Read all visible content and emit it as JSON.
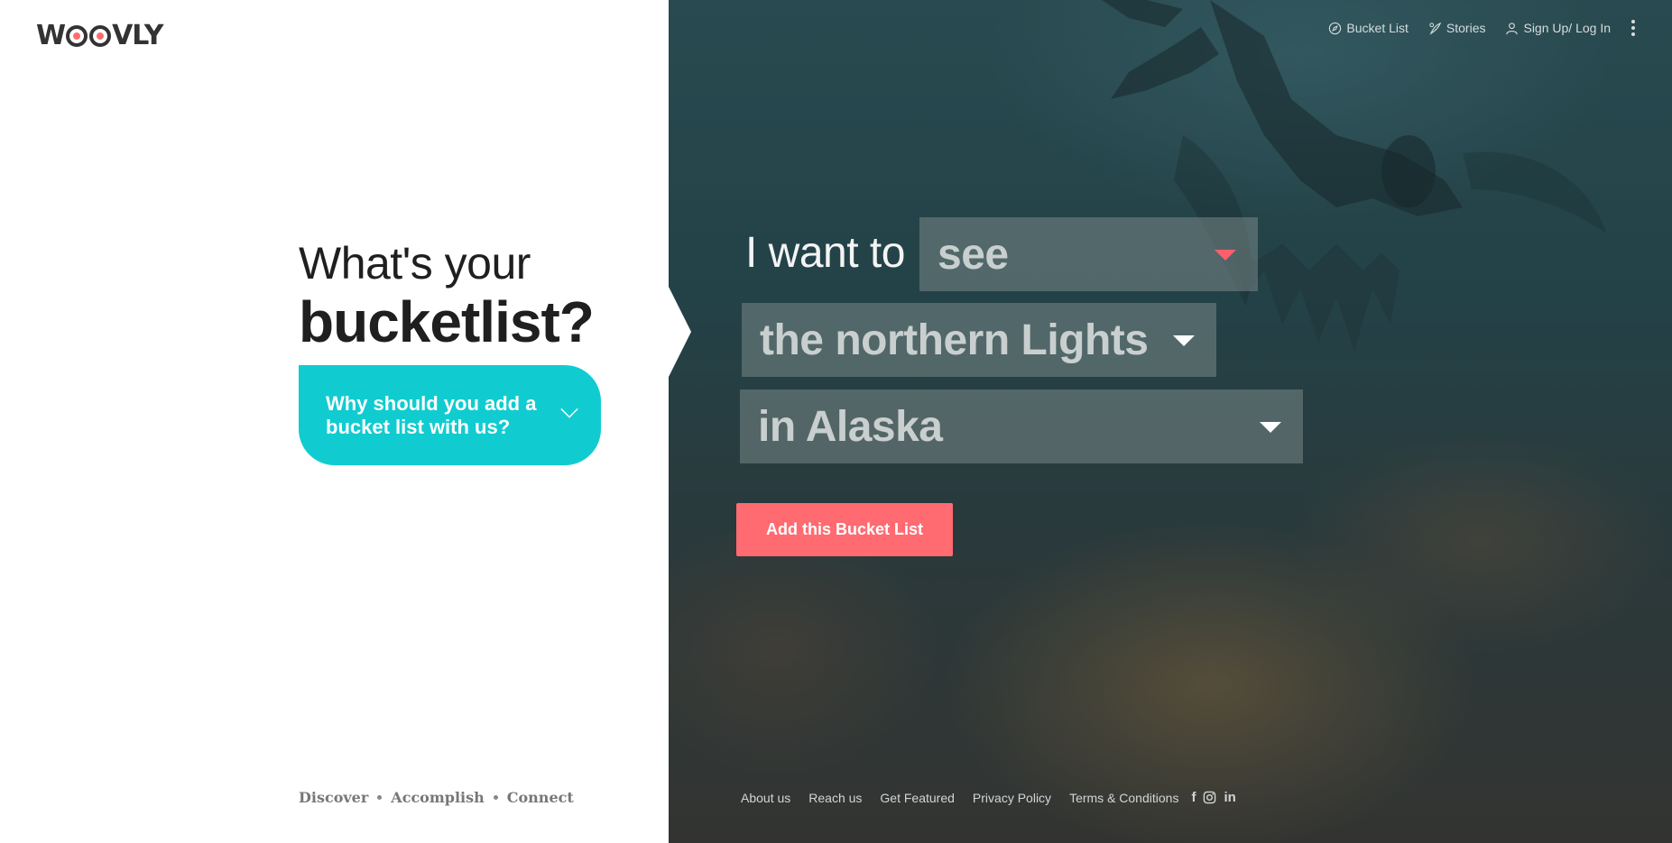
{
  "brand": {
    "logo_text": "WOOVLY"
  },
  "nav": {
    "bucket_list": "Bucket List",
    "stories": "Stories",
    "signup_login": "Sign Up/ Log In"
  },
  "hero": {
    "line1": "What's your",
    "line2": "bucketlist?",
    "why_button": "Why should you add a bucket list with us?"
  },
  "tagline": {
    "items": [
      "Discover",
      "Accomplish",
      "Connect"
    ]
  },
  "form": {
    "prefix": "I want to",
    "verb_selected": "see",
    "object_selected": "the northern Lights",
    "place_selected": "in Alaska",
    "add_button": "Add this Bucket List"
  },
  "footer": {
    "links": [
      "About us",
      "Reach us",
      "Get Featured",
      "Privacy Policy",
      "Terms & Conditions"
    ],
    "social": {
      "facebook": "f",
      "instagram": "instagram-icon",
      "linkedin": "in"
    }
  },
  "colors": {
    "accent_teal": "#10ccd0",
    "accent_coral": "#ff6b71",
    "caret_red": "#ff5f6d"
  }
}
